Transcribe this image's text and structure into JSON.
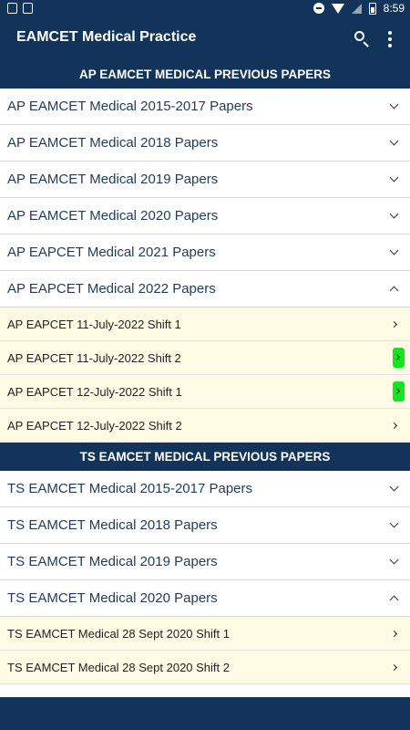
{
  "status_bar": {
    "time": "8:59",
    "icons": [
      "image-icon",
      "notification-a-icon",
      "do-not-disturb-icon",
      "wifi-icon",
      "cell-signal-icon",
      "battery-icon"
    ]
  },
  "app_bar": {
    "title": "EAMCET Medical Practice",
    "icons": [
      "search-icon",
      "overflow-menu-icon"
    ]
  },
  "colors": {
    "primary": "#13345a",
    "child_bg": "#fdfbe4",
    "highlight": "#12e61e"
  },
  "sections": [
    {
      "header": "AP EAMCET MEDICAL PREVIOUS PAPERS",
      "groups": [
        {
          "label": "AP EAMCET Medical 2015-2017 Papers",
          "expanded": false
        },
        {
          "label": "AP EAMCET Medical 2018 Papers",
          "expanded": false
        },
        {
          "label": "AP EAMCET Medical 2019 Papers",
          "expanded": false
        },
        {
          "label": "AP EAMCET Medical 2020 Papers",
          "expanded": false
        },
        {
          "label": "AP EAPCET Medical 2021 Papers",
          "expanded": false
        },
        {
          "label": "AP EAPCET Medical 2022 Papers",
          "expanded": true,
          "children": [
            {
              "label": "AP EAPCET 11-July-2022 Shift 1",
              "highlighted": false
            },
            {
              "label": "AP EAPCET 11-July-2022 Shift 2",
              "highlighted": true
            },
            {
              "label": "AP EAPCET 12-July-2022 Shift 1",
              "highlighted": true
            },
            {
              "label": "AP EAPCET 12-July-2022 Shift 2",
              "highlighted": false
            }
          ]
        }
      ]
    },
    {
      "header": "TS EAMCET MEDICAL PREVIOUS PAPERS",
      "groups": [
        {
          "label": "TS EAMCET Medical 2015-2017 Papers",
          "expanded": false
        },
        {
          "label": "TS EAMCET Medical 2018 Papers",
          "expanded": false
        },
        {
          "label": "TS EAMCET Medical 2019 Papers",
          "expanded": false
        },
        {
          "label": "TS EAMCET Medical 2020 Papers",
          "expanded": true,
          "children": [
            {
              "label": "TS EAMCET Medical 28 Sept 2020 Shift 1",
              "highlighted": false
            },
            {
              "label": "TS EAMCET Medical 28 Sept 2020 Shift 2",
              "highlighted": false
            }
          ]
        }
      ]
    }
  ]
}
